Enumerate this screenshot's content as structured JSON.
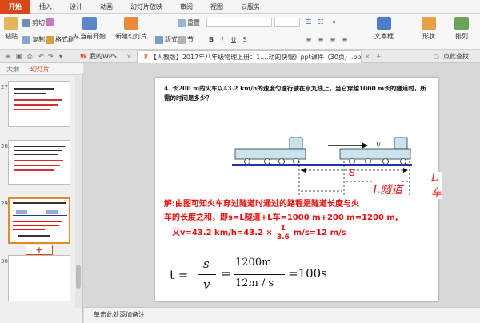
{
  "menu": {
    "tabs": [
      "开始",
      "插入",
      "设计",
      "动画",
      "幻灯片放映",
      "审阅",
      "视图",
      "云服务"
    ],
    "active": 0
  },
  "ribbon": {
    "paste": "粘贴",
    "cut": "剪切",
    "copy": "复制",
    "format_painter": "格式刷",
    "from_current": "从当前开始",
    "new_slide": "新建幻灯片",
    "layout": "版式",
    "reset": "重置",
    "section": "节",
    "textbox": "文本框",
    "shape": "形状",
    "arrange": "排列"
  },
  "tabbar": {
    "home": "我的WPS",
    "doc_tab": "【人教版】2017年八年级物理上册：1....动的快慢》ppt课件（30页）.ppt",
    "beautify": "点此查找"
  },
  "leftpane": {
    "tab_outline": "大纲",
    "tab_slides": "幻灯片",
    "slide_numbers": [
      "27",
      "28",
      "29",
      "30"
    ],
    "selected": "29",
    "add_label": "+"
  },
  "notes_placeholder": "单击此处添加备注",
  "slide": {
    "question": "4. 长200 m的火车以43.2 km/h的速度匀速行驶在京九线上，当它穿越1000 m长的隧道时，所需的时间是多少？",
    "velocity_label": "v",
    "s_label": "s",
    "tunnel_label": "L隧道",
    "train_label": "L车",
    "solution_line1": "解:由图可知火车穿过隧道时通过的路程是隧道长度与火",
    "solution_line2": "车的长度之和，即s=L隧道+L车=1000 m+200 m=1200 m,",
    "solution_line3a": "又v=43.2 km/h=43.2 ×",
    "frac_num": "1",
    "frac_den": "3.6",
    "solution_line3b": "m/s=12 m/s",
    "formula_t": "t =",
    "formula_s": "s",
    "formula_v": "v",
    "formula_eq1": "=",
    "formula_num": "1200m",
    "formula_den": "12m / s",
    "formula_result": "=100s"
  },
  "colors": {
    "accent": "#d9481b",
    "red_text": "#e4100f",
    "track": "#2236a8"
  }
}
